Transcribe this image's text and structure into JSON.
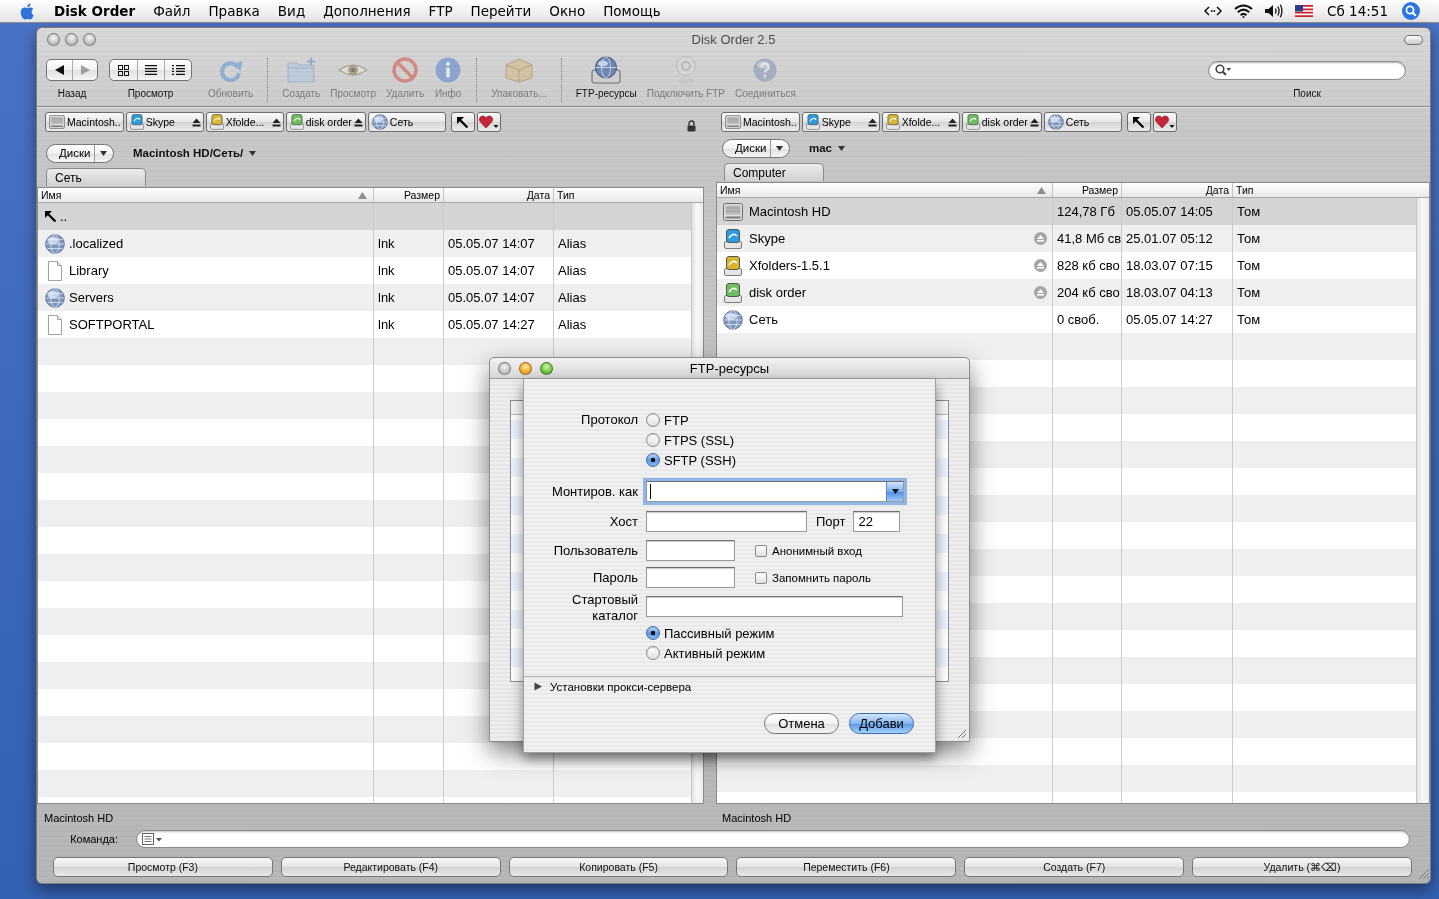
{
  "menu_bar": {
    "app_name": "Disk Order",
    "menus": [
      "Файл",
      "Правка",
      "Вид",
      "Дополнения",
      "FTP",
      "Перейти",
      "Окно",
      "Помощь"
    ],
    "clock": "Сб 14:51"
  },
  "window": {
    "title": "Disk Order 2.5"
  },
  "toolbar": {
    "items": [
      {
        "kind": "nav",
        "label": "Назад",
        "disabled": false,
        "segments": [
          {
            "disabled": false
          },
          {
            "disabled": true
          }
        ]
      },
      {
        "kind": "view",
        "label": "Просмотр",
        "disabled": false
      },
      {
        "kind": "button",
        "label": "Обновить",
        "disabled": true
      },
      {
        "kind": "separator"
      },
      {
        "kind": "button",
        "label": "Создать",
        "disabled": true
      },
      {
        "kind": "button",
        "label": "Просмотр",
        "disabled": true
      },
      {
        "kind": "button",
        "label": "Удалить",
        "disabled": true
      },
      {
        "kind": "button",
        "label": "Инфо",
        "disabled": true
      },
      {
        "kind": "separator"
      },
      {
        "kind": "button",
        "label": "Упаковать...",
        "disabled": true
      },
      {
        "kind": "separator"
      },
      {
        "kind": "button",
        "label": "FTP-ресурсы",
        "disabled": false
      },
      {
        "kind": "button",
        "label": "Подключить FTP",
        "disabled": true
      },
      {
        "kind": "button",
        "label": "Соединиться",
        "disabled": true
      }
    ],
    "search": {
      "label": "Поиск"
    }
  },
  "panes": [
    {
      "drives": [
        {
          "kind": "hard-disk",
          "label": "Macintosh..",
          "ejectable": false
        },
        {
          "kind": "disk-image",
          "label": "Skype",
          "ejectable": true
        },
        {
          "kind": "disk-image",
          "label": "Xfolde...",
          "ejectable": true
        },
        {
          "kind": "disk-image",
          "label": "disk order",
          "ejectable": true
        },
        {
          "kind": "network",
          "label": "Сеть",
          "ejectable": false
        }
      ],
      "disks_button": "Диски",
      "path": "Macintosh HD/Сеть/",
      "tab": "Сеть",
      "columns": [
        {
          "label": "Имя",
          "sorted": true
        },
        {
          "label": "Размер",
          "sorted": false
        },
        {
          "label": "Дата",
          "sorted": false
        },
        {
          "label": "Тип",
          "sorted": false
        }
      ],
      "rows": [
        {
          "kind": "parent",
          "name": "..",
          "ejectable": false,
          "selected": true
        },
        {
          "kind": "network",
          "name": ".localized",
          "size": "lnk",
          "date": "05.05.07 14:07",
          "type": "Alias",
          "ejectable": false,
          "selected": false
        },
        {
          "kind": "file",
          "name": "Library",
          "size": "lnk",
          "date": "05.05.07 14:07",
          "type": "Alias",
          "ejectable": false,
          "selected": false
        },
        {
          "kind": "network",
          "name": "Servers",
          "size": "lnk",
          "date": "05.05.07 14:07",
          "type": "Alias",
          "ejectable": false,
          "selected": false
        },
        {
          "kind": "file",
          "name": "SOFTPORTAL",
          "size": "lnk",
          "date": "05.05.07 14:27",
          "type": "Alias",
          "ejectable": false,
          "selected": false
        }
      ],
      "status": "Macintosh HD"
    },
    {
      "drives": [
        {
          "kind": "hard-disk",
          "label": "Macintosh..",
          "ejectable": false
        },
        {
          "kind": "disk-image",
          "label": "Skype",
          "ejectable": true
        },
        {
          "kind": "disk-image",
          "label": "Xfolde...",
          "ejectable": true
        },
        {
          "kind": "disk-image",
          "label": "disk order",
          "ejectable": true
        },
        {
          "kind": "network",
          "label": "Сеть",
          "ejectable": false
        }
      ],
      "disks_button": "Диски",
      "path": "mac",
      "tab": "Computer",
      "columns": [
        {
          "label": "Имя",
          "sorted": true
        },
        {
          "label": "Размер",
          "sorted": false
        },
        {
          "label": "Дата",
          "sorted": false
        },
        {
          "label": "Тип",
          "sorted": false
        }
      ],
      "rows": [
        {
          "kind": "hard-disk",
          "name": "Macintosh HD",
          "size": "124,78 Гб",
          "date": "05.05.07 14:05",
          "type": "Том",
          "ejectable": false,
          "selected": true
        },
        {
          "kind": "disk-image",
          "name": "Skype",
          "size": "41,8 Мб св",
          "date": "25.01.07 05:12",
          "type": "Том",
          "ejectable": true,
          "selected": false
        },
        {
          "kind": "disk-image",
          "name": "Xfolders-1.5.1",
          "size": "828 кб сво",
          "date": "18.03.07 07:15",
          "type": "Том",
          "ejectable": true,
          "selected": false
        },
        {
          "kind": "disk-image",
          "name": "disk order",
          "size": "204 кб сво",
          "date": "18.03.07 04:13",
          "type": "Том",
          "ejectable": true,
          "selected": false
        },
        {
          "kind": "network",
          "name": "Сеть",
          "size": "0 своб.",
          "date": "05.05.07 14:27",
          "type": "Том",
          "ejectable": false,
          "selected": false
        }
      ],
      "status": "Macintosh HD"
    }
  ],
  "command": {
    "label": "Команда:"
  },
  "function_buttons": [
    "Просмотр (F3)",
    "Редактировать (F4)",
    "Копировать (F5)",
    "Переместить (F6)",
    "Создать (F7)",
    "Удалить (⌘⌫)"
  ],
  "ftp_window": {
    "title": "FTP-ресурсы",
    "sheet": {
      "protocol": {
        "label": "Протокол",
        "options": [
          {
            "label": "FTP",
            "selected": false
          },
          {
            "label": "FTPS (SSL)",
            "selected": false
          },
          {
            "label": "SFTP (SSH)",
            "selected": true
          }
        ]
      },
      "mount_as": {
        "label": "Монтиров. как",
        "focused": true
      },
      "host": {
        "label": "Хост"
      },
      "port": {
        "label": "Порт",
        "value": "22"
      },
      "user": {
        "label": "Пользователь"
      },
      "anonymous": {
        "label": "Анонимный вход",
        "checked": false
      },
      "password": {
        "label": "Пароль"
      },
      "remember_password": {
        "label": "Запомнить пароль",
        "checked": false
      },
      "start_dir": {
        "label": "Стартовый каталог"
      },
      "mode": {
        "options": [
          {
            "label": "Пассивный режим",
            "selected": true
          },
          {
            "label": "Активный режим",
            "selected": false
          }
        ]
      },
      "proxy": {
        "label": "Установки прокси-сервера",
        "expanded": false
      },
      "buttons": [
        {
          "label": "Отмена",
          "default": false
        },
        {
          "label": "Добави",
          "default": true
        }
      ]
    }
  }
}
